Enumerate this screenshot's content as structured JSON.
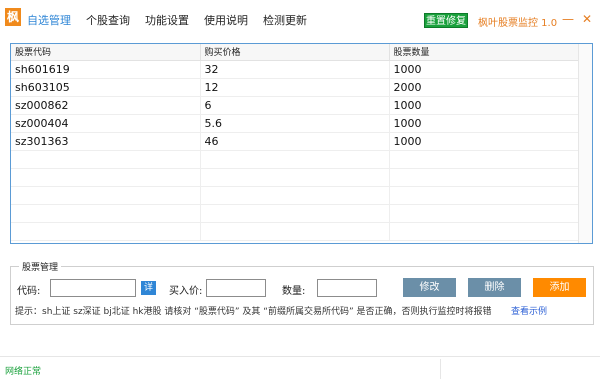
{
  "app": {
    "logo_char": "枫",
    "title": "枫叶股票监控 1.0",
    "reset_label": "重置修复",
    "minimize_glyph": "—",
    "close_glyph": "✕"
  },
  "nav": [
    {
      "label": "自选管理",
      "active": true
    },
    {
      "label": "个股查询",
      "active": false
    },
    {
      "label": "功能设置",
      "active": false
    },
    {
      "label": "使用说明",
      "active": false
    },
    {
      "label": "检测更新",
      "active": false
    }
  ],
  "table": {
    "columns": [
      "股票代码",
      "购买价格",
      "股票数量"
    ],
    "rows": [
      [
        "sh601619",
        "32",
        "1000"
      ],
      [
        "sh603105",
        "12",
        "2000"
      ],
      [
        "sz000862",
        "6",
        "1000"
      ],
      [
        "sz000404",
        "5.6",
        "1000"
      ],
      [
        "sz301363",
        "46",
        "1000"
      ]
    ]
  },
  "group": {
    "title": "股票管理",
    "code_label": "代码:",
    "detail_label": "详",
    "price_label": "买入价:",
    "qty_label": "数量:",
    "code_value": "",
    "price_value": "",
    "qty_value": "",
    "modify_label": "修改",
    "delete_label": "删除",
    "add_label": "添加",
    "hint": "提示：sh上证 sz深证 bj北证 hk港股  请核对 “股票代码” 及其 “前缀所属交易所代码” 是否正确，否则执行监控时将报错",
    "example_link": "查看示例"
  },
  "status": {
    "text": "网络正常"
  },
  "colors": {
    "accent_blue": "#2f86d6",
    "brand_orange": "#f08a1c",
    "status_green": "#1aa13c",
    "button_gray": "#6b8fa8",
    "add_orange": "#ff8a00"
  }
}
